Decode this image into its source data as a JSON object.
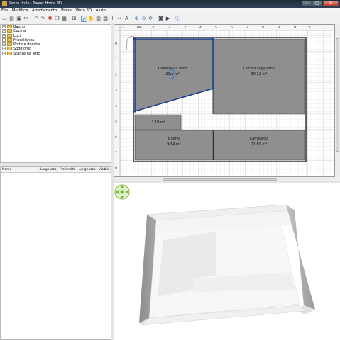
{
  "window": {
    "title": "Senza titolo - Sweet Home 3D",
    "minimize": "–",
    "maximize": "□",
    "close": "✕"
  },
  "menu": [
    "File",
    "Modifica",
    "Arredamento",
    "Piano",
    "Vista 3D",
    "Aiuto"
  ],
  "toolbar": {
    "icons": [
      "new-icon",
      "open-icon",
      "save-icon",
      "cut-icon",
      "sep",
      "undo-icon",
      "redo-icon",
      "delete-icon",
      "copy-icon",
      "paste-icon",
      "sep",
      "add-furniture-icon",
      "sep",
      "select-icon",
      "pan-icon",
      "create-walls-icon",
      "create-rooms-icon",
      "create-polylines-icon",
      "create-dimensions-icon",
      "create-labels-icon",
      "sep",
      "zoom-in-icon",
      "zoom-out-icon",
      "rotate-icon",
      "sep",
      "create-photo-icon",
      "create-video-icon",
      "sep",
      "help-icon"
    ]
  },
  "catalog": {
    "categories": [
      "Bagno",
      "Cucina",
      "Luci",
      "Miscellanea",
      "Porte e finestre",
      "Soggiorno",
      "Stanze da letto"
    ]
  },
  "furniture_table": {
    "columns": [
      "Nome",
      "Larghezza",
      "Profondità",
      "Lunghezza",
      "Visibile"
    ]
  },
  "plan": {
    "ruler_x": [
      "-2",
      "0",
      "1",
      "2",
      "3",
      "4",
      "5",
      "6",
      "7",
      "8",
      "9",
      "10",
      "11"
    ],
    "ruler_x_unit": "m",
    "ruler_y": [
      "0",
      "1",
      "2",
      "3",
      "4",
      "5",
      "6",
      "7",
      "8"
    ],
    "rooms": [
      {
        "name": "Camera da letto",
        "area": "20,1 m²"
      },
      {
        "name": "Cucina Soggiorno",
        "area": "30,12 m²"
      },
      {
        "name": "",
        "area": "3,19 m²"
      },
      {
        "name": "Bagno",
        "area": "9,84 m²"
      },
      {
        "name": "Cameretta",
        "area": "11,89 m²"
      }
    ]
  },
  "colors": {
    "room_fill": "#8f8f8f",
    "selection": "#1f3e8c",
    "wall": "#303030",
    "grid": "#d7d7d7",
    "navigator": "#7cbc35"
  }
}
